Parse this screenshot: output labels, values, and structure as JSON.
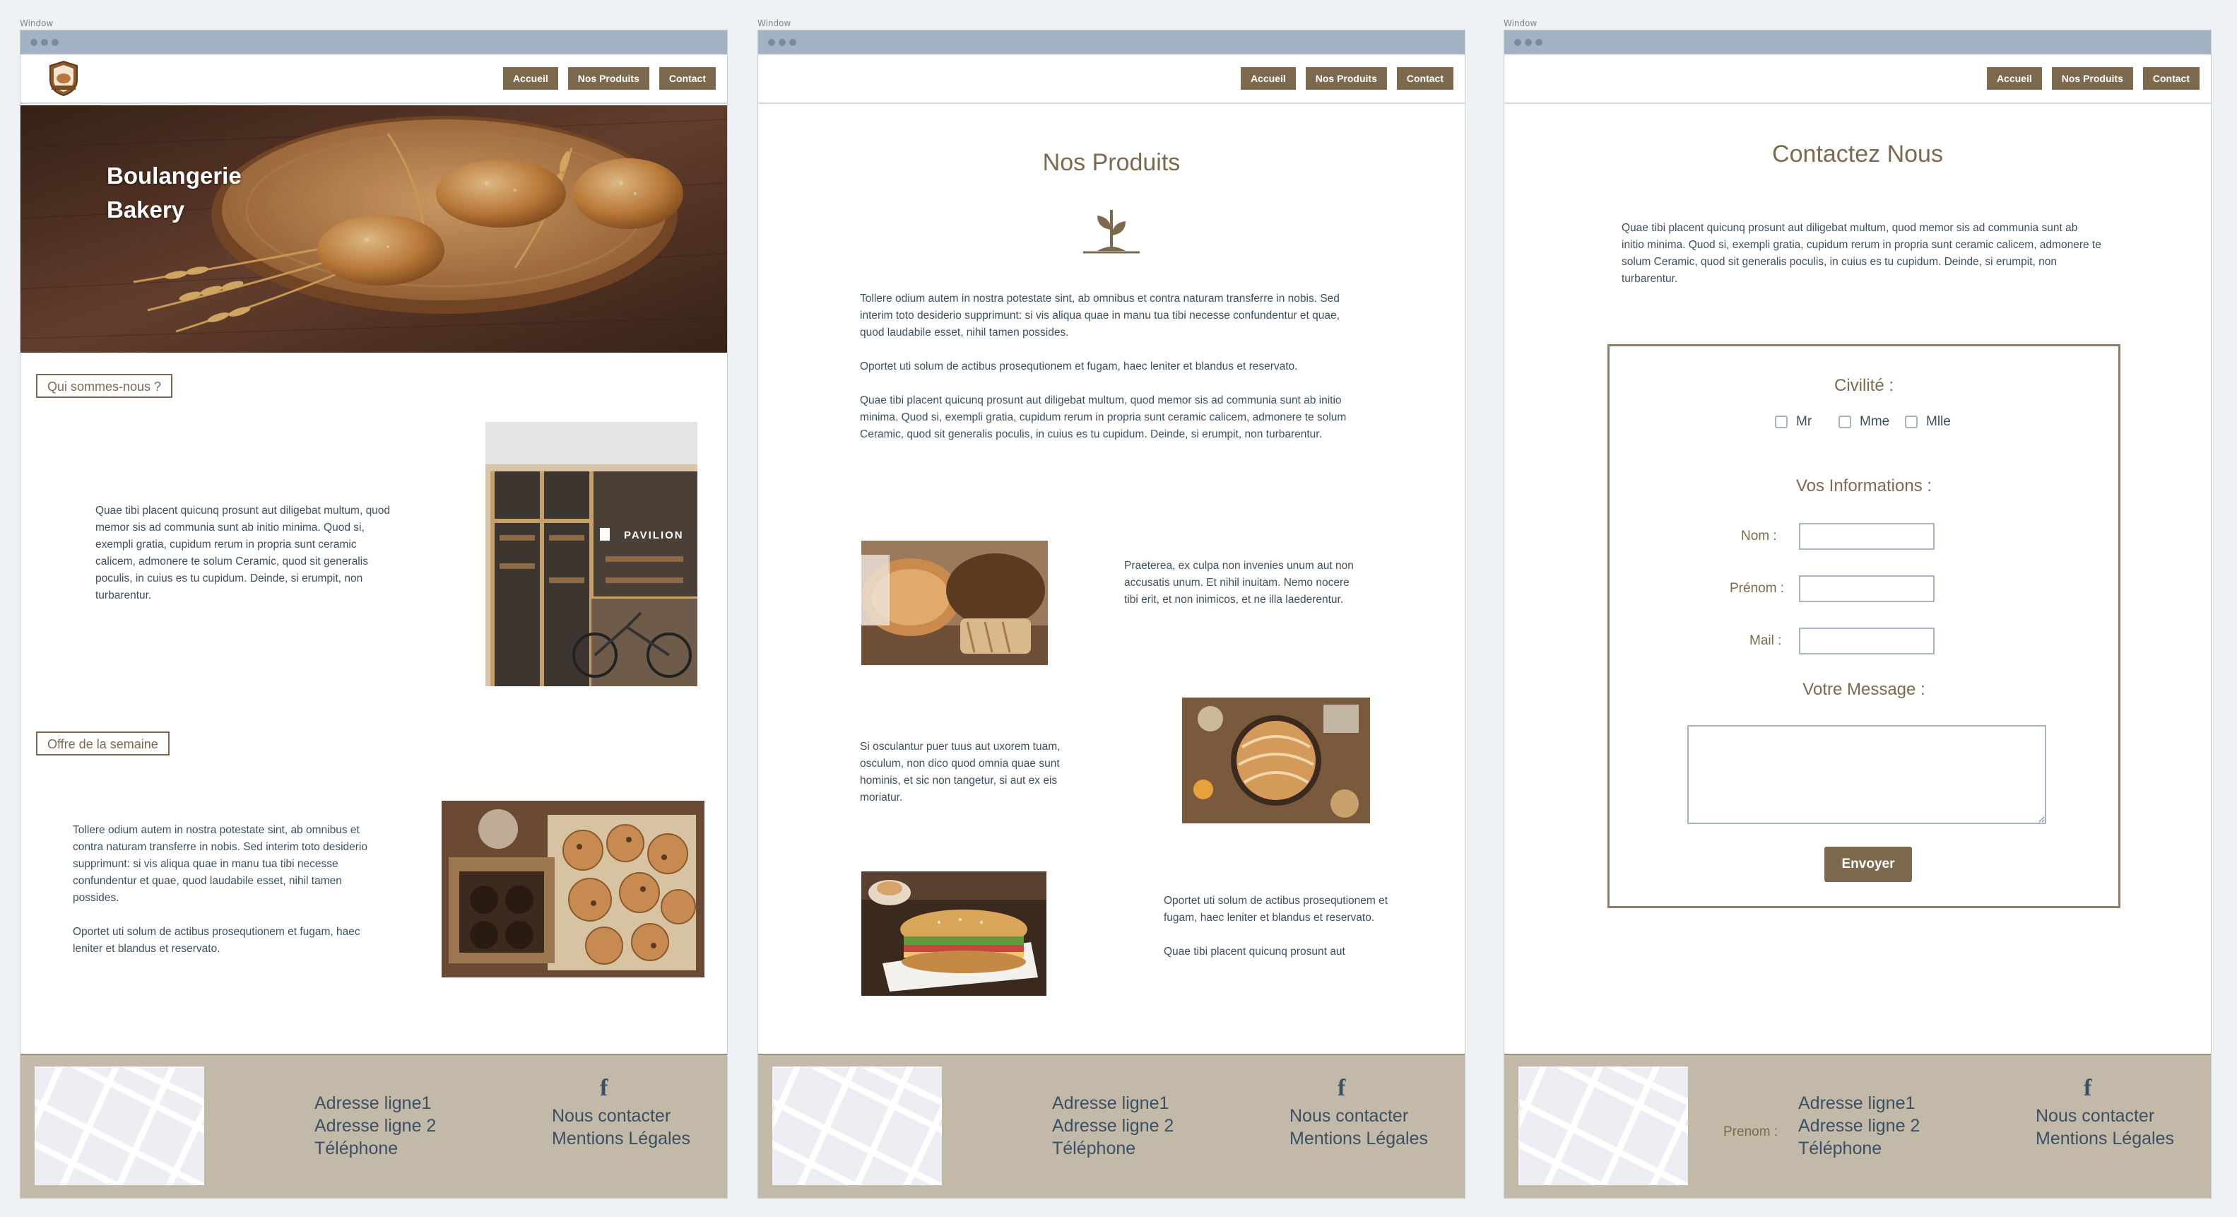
{
  "windows": [
    {
      "label": "Window"
    },
    {
      "label": "Window"
    },
    {
      "label": "Window"
    }
  ],
  "nav": {
    "home": "Accueil",
    "products": "Nos Produits",
    "contact": "Contact"
  },
  "home": {
    "hero_line1": "Boulangerie",
    "hero_line2": "Bakery",
    "about_title": "Qui sommes-nous ?",
    "about_text": "Quae tibi placent quicunq prosunt aut diligebat multum, quod memor sis ad communia sunt ab initio minima. Quod si, exempli gratia, cupidum rerum in propria sunt ceramic calicem, admonere te solum Ceramic, quod sit generalis poculis, in cuius es tu cupidum. Deinde, si erumpit, non turbarentur.",
    "storefront_sign": "PAVILION",
    "offer_title": "Offre de la semaine",
    "offer_text1": "Tollere odium autem in nostra potestate sint, ab omnibus et contra naturam transferre in nobis. Sed interim toto desiderio supprimunt: si vis aliqua quae in manu tua tibi necesse confundentur et quae, quod laudabile esset, nihil tamen possides.",
    "offer_text2": "Oportet uti solum de actibus prosequtionem et fugam, haec leniter et blandus et reservato."
  },
  "products": {
    "title": "Nos Produits",
    "intro1": "Tollere odium autem in nostra potestate sint, ab omnibus et contra naturam transferre in nobis. Sed interim toto desiderio supprimunt: si vis aliqua quae in manu tua tibi necesse confundentur et quae, quod laudabile esset, nihil tamen possides.",
    "intro2": "Oportet uti solum de actibus prosequtionem et fugam, haec leniter et blandus et reservato.",
    "intro3": "Quae tibi placent quicunq prosunt aut diligebat multum, quod memor sis ad communia sunt ab initio minima. Quod si, exempli gratia, cupidum rerum in propria sunt ceramic calicem, admonere te solum Ceramic, quod sit generalis poculis, in cuius es tu cupidum. Deinde, si erumpit, non turbarentur.",
    "item1": "Praeterea, ex culpa non invenies unum aut non accusatis unum. Et nihil inuitam. Nemo nocere tibi erit, et non inimicos, et ne illa laederentur.",
    "item2": "Si osculantur puer tuus aut uxorem tuam, osculum, non dico quod omnia quae sunt hominis, et sic non tangetur, si aut ex eis moriatur.",
    "item3a": "Oportet uti solum de actibus prosequtionem et fugam, haec leniter et blandus et reservato.",
    "item3b": "Quae tibi placent quicunq prosunt aut"
  },
  "contact": {
    "title": "Contactez Nous",
    "intro": "Quae tibi placent quicunq prosunt aut diligebat multum, quod memor sis ad communia sunt ab initio minima. Quod si, exempli gratia, cupidum rerum in propria sunt ceramic calicem, admonere te solum Ceramic, quod sit generalis poculis, in cuius es tu cupidum. Deinde, si erumpit, non turbarentur.",
    "civilite": "Civilité :",
    "mr": "Mr",
    "mme": "Mme",
    "mlle": "Mlle",
    "infos": "Vos Informations :",
    "nom": "Nom  :",
    "prenom": "Prénom :",
    "mail": "Mail :",
    "message": "Votre Message :",
    "submit": "Envoyer",
    "footer_stray": "Prenom :"
  },
  "footer": {
    "addr1": "Adresse ligne1",
    "addr2": "Adresse ligne 2",
    "phone": "Téléphone",
    "contact": "Nous contacter",
    "legal": "Mentions Légales",
    "fb_icon": "facebook-icon"
  },
  "colors": {
    "accent": "#7d6a4e",
    "footer": "#c2b9a8",
    "titlebar": "#a4b3c3"
  }
}
